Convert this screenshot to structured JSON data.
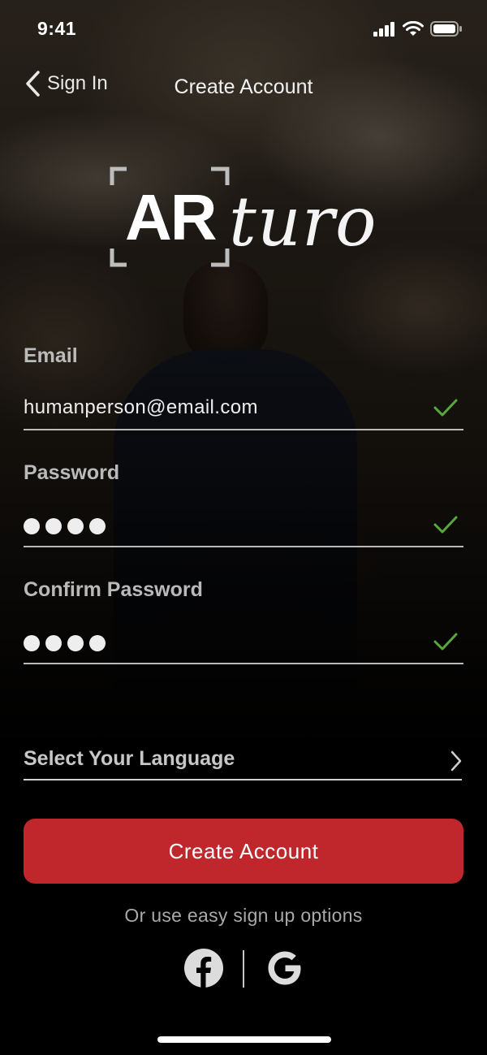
{
  "status_bar": {
    "time": "9:41"
  },
  "nav": {
    "back_label": "Sign In",
    "title": "Create Account"
  },
  "logo": {
    "part1": "AR",
    "part2": "turo"
  },
  "form": {
    "email": {
      "label": "Email",
      "value": "humanperson@email.com",
      "valid": true
    },
    "password": {
      "label": "Password",
      "masked_length": 4,
      "valid": true
    },
    "confirm_password": {
      "label": "Confirm Password",
      "masked_length": 4,
      "valid": true
    },
    "language": {
      "placeholder": "Select Your Language"
    }
  },
  "primary_button": {
    "label": "Create Account"
  },
  "alt_signup": {
    "text": "Or use easy sign up options",
    "options": [
      "facebook-icon",
      "google-icon"
    ]
  },
  "colors": {
    "accent": "#c0272d",
    "check": "#57a93a",
    "background": "#000000"
  }
}
